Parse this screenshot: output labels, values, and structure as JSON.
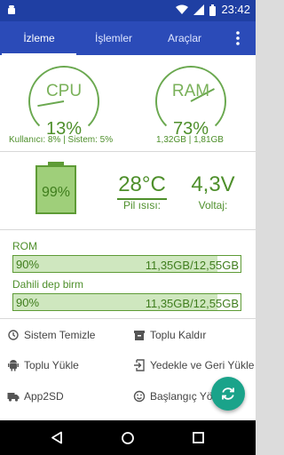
{
  "status_bar": {
    "time": "23:42"
  },
  "tabs": [
    {
      "label": "İzleme",
      "active": true
    },
    {
      "label": "İşlemler",
      "active": false
    },
    {
      "label": "Araçlar",
      "active": false
    }
  ],
  "cpu": {
    "label": "CPU",
    "percent": "13%",
    "level": 0.13,
    "detail": "Kullanıcı: 8% | Sistem: 5%"
  },
  "ram": {
    "label": "RAM",
    "percent": "73%",
    "level": 0.73,
    "detail": "1,32GB | 1,81GB"
  },
  "battery": {
    "level_text": "99%",
    "level": 0.99,
    "temperature": "28°C",
    "temperature_label": "Pil ısısı:",
    "voltage": "4,3V",
    "voltage_label": "Voltaj:"
  },
  "storage": [
    {
      "title": "ROM",
      "percent": "90%",
      "level": 0.9,
      "usage": "11,35GB/12,55GB"
    },
    {
      "title": "Dahili dep birm",
      "percent": "90%",
      "level": 0.9,
      "usage": "11,35GB/12,55GB"
    }
  ],
  "actions": [
    {
      "label": "Sistem Temizle",
      "icon": "history-icon"
    },
    {
      "label": "Toplu Kaldır",
      "icon": "archive-icon"
    },
    {
      "label": "Toplu Yükle",
      "icon": "android-icon"
    },
    {
      "label": "Yedekle ve Geri Yükle",
      "icon": "exit-to-app-icon"
    },
    {
      "label": "App2SD",
      "icon": "truck-icon"
    },
    {
      "label": "Başlangıç Yön",
      "icon": "smiley-icon"
    }
  ],
  "colors": {
    "primary": "#2b4bb8",
    "status_bar": "#1f3fa3",
    "accent_green": "#4e8f2b",
    "fab": "#1aa38a"
  }
}
